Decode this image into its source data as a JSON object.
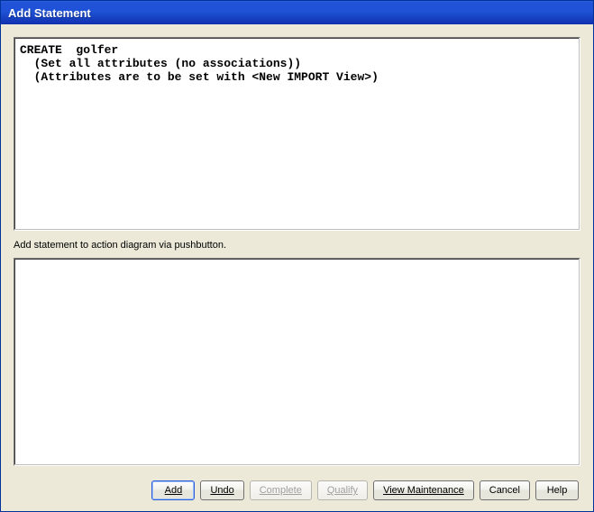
{
  "window": {
    "title": "Add Statement"
  },
  "code": {
    "line1": "CREATE  golfer",
    "line2": "  (Set all attributes (no associations))",
    "line3": "  (Attributes are to be set with <New IMPORT View>)"
  },
  "hint": "Add statement to action diagram via pushbutton.",
  "buttons": {
    "add": "Add",
    "undo": "Undo",
    "complete": "Complete",
    "qualify": "Qualify",
    "view_maintenance": "View Maintenance",
    "cancel": "Cancel",
    "help": "Help"
  }
}
